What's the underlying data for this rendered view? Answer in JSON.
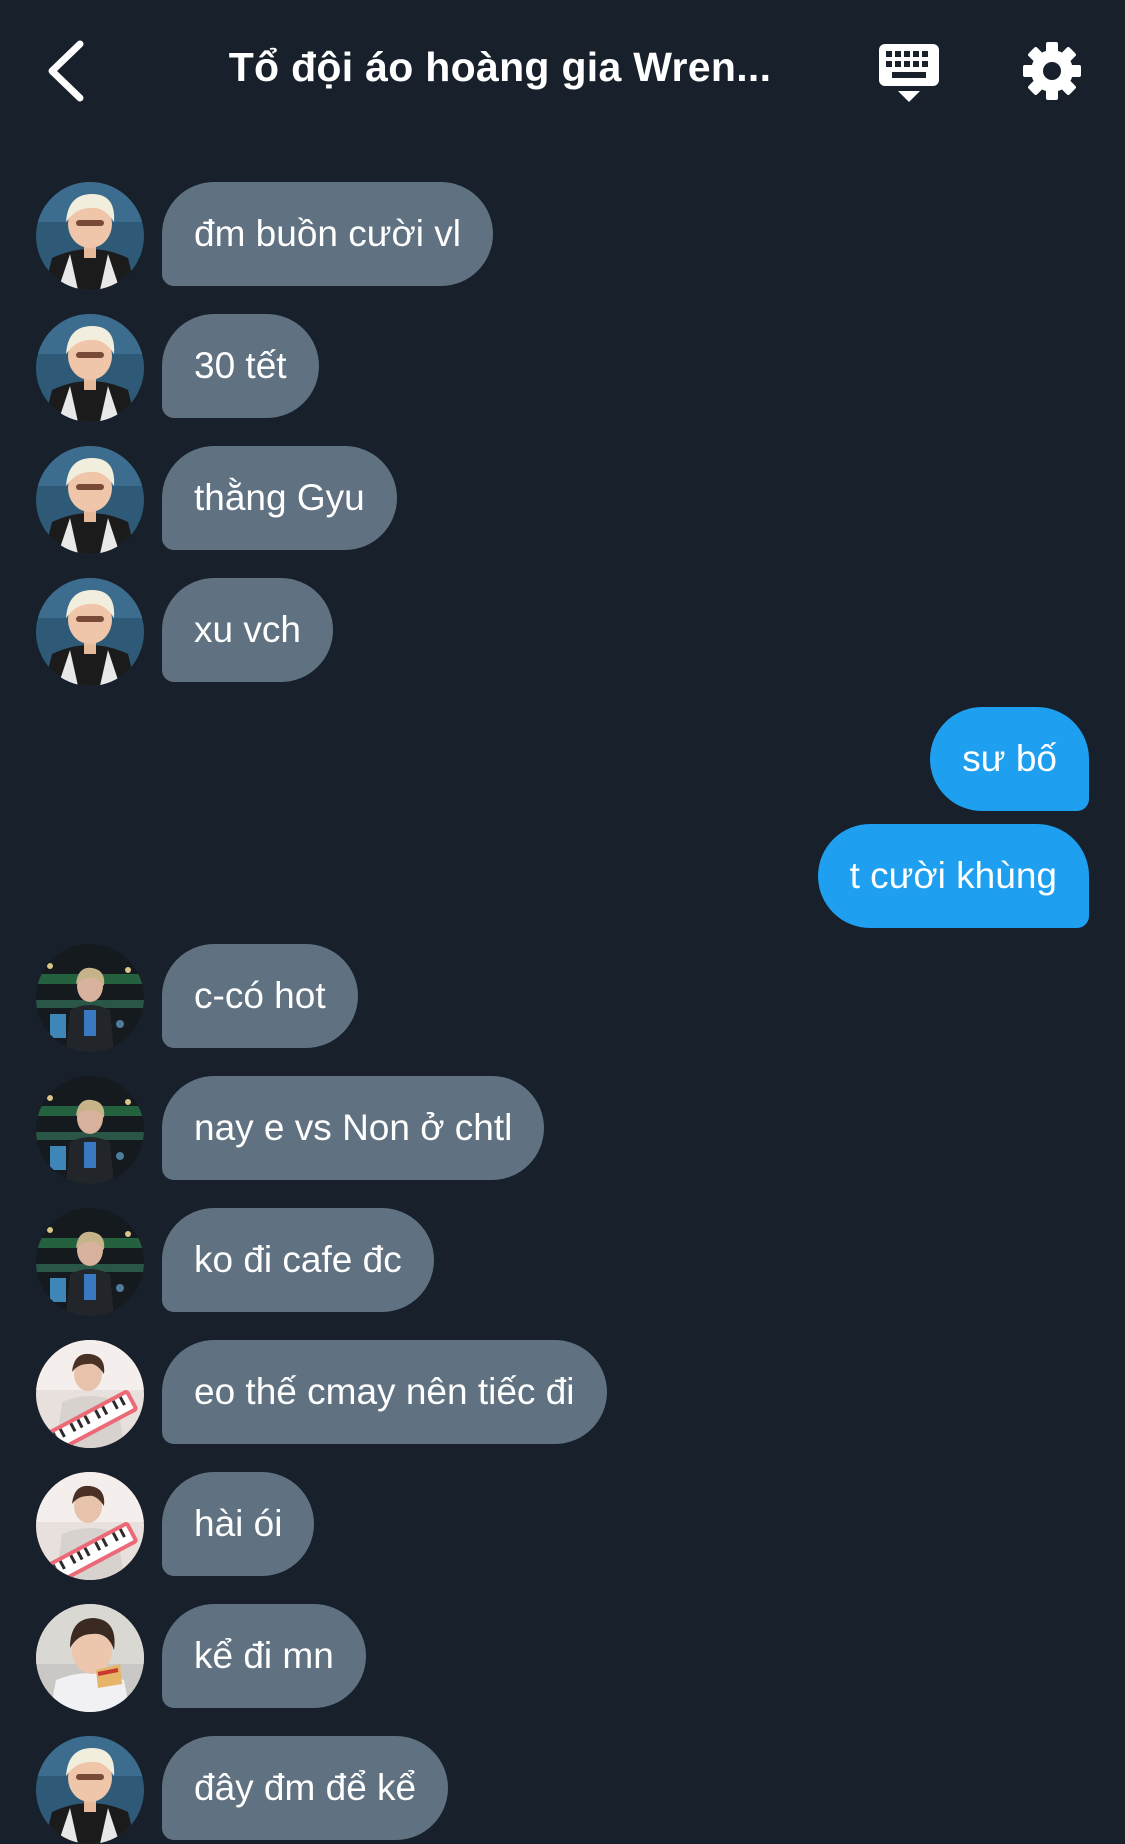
{
  "header": {
    "title": "Tổ đội áo hoàng gia Wren...",
    "back_icon": "chevron-left-icon",
    "keyboard_icon": "keyboard-icon",
    "settings_icon": "gear-icon"
  },
  "colors": {
    "background": "#17202b",
    "incoming_bubble": "#607181",
    "outgoing_bubble": "#1e9ff0",
    "text": "#ffffff"
  },
  "messages": [
    {
      "text": "đm buồn cười vl",
      "direction": "incoming",
      "sender": "a"
    },
    {
      "text": "30 tết",
      "direction": "incoming",
      "sender": "a"
    },
    {
      "text": "thằng Gyu",
      "direction": "incoming",
      "sender": "a"
    },
    {
      "text": "xu vch",
      "direction": "incoming",
      "sender": "a"
    },
    {
      "text": "sư bố",
      "direction": "outgoing"
    },
    {
      "text": "t cười khùng",
      "direction": "outgoing"
    },
    {
      "text": "c-có hot",
      "direction": "incoming",
      "sender": "b"
    },
    {
      "text": "nay e vs Non ở chtl",
      "direction": "incoming",
      "sender": "b"
    },
    {
      "text": "ko đi cafe đc",
      "direction": "incoming",
      "sender": "b"
    },
    {
      "text": "eo thế cmay nên tiếc đi",
      "direction": "incoming",
      "sender": "c"
    },
    {
      "text": "hài ói",
      "direction": "incoming",
      "sender": "c"
    },
    {
      "text": "kể đi mn",
      "direction": "incoming",
      "sender": "d"
    },
    {
      "text": "đây đm để kể",
      "direction": "incoming",
      "sender": "a"
    }
  ]
}
